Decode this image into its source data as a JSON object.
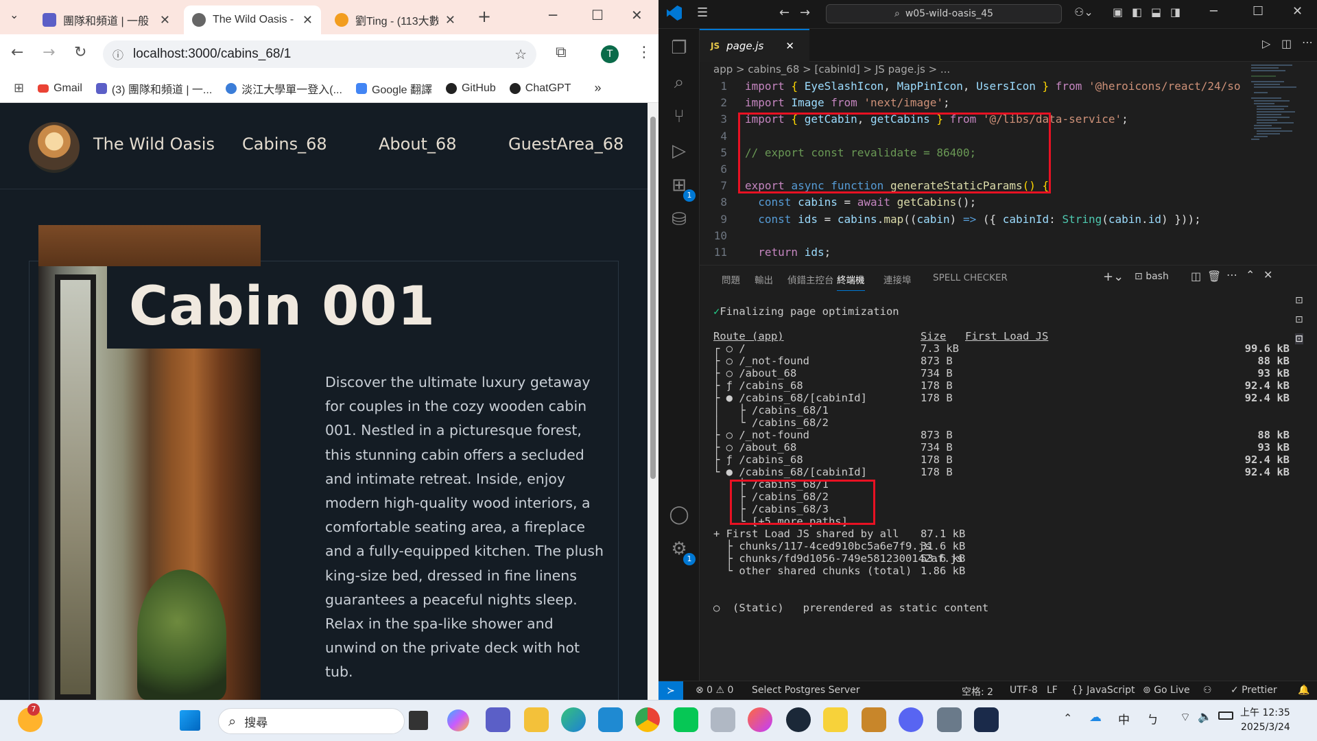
{
  "browser": {
    "tabs": [
      {
        "title": "團隊和頻道 | 一般",
        "icon": "teams-icon"
      },
      {
        "title": "The Wild Oasis - ",
        "icon": "globe-icon"
      },
      {
        "title": "劉Ting - (113大數",
        "icon": "cocomelon-icon"
      }
    ],
    "new_tab": "+",
    "url": "localhost:3000/cabins_68/1",
    "profile_initial": "T",
    "bookmarks": [
      {
        "label": "Gmail",
        "icon": "gmail-icon"
      },
      {
        "label": "(3) 團隊和頻道 | 一...",
        "icon": "teams-icon"
      },
      {
        "label": "淡江大學單一登入(...",
        "icon": "tku-icon"
      },
      {
        "label": "Google 翻譯",
        "icon": "translate-icon"
      },
      {
        "label": "GitHub",
        "icon": "github-icon"
      },
      {
        "label": "ChatGPT",
        "icon": "chatgpt-icon"
      }
    ],
    "more": "»"
  },
  "site": {
    "brand": "The Wild Oasis",
    "nav": [
      "Cabins_68",
      "About_68",
      "GuestArea_68"
    ],
    "cabin_title": "Cabin 001",
    "description": "Discover the ultimate luxury getaway for couples in the cozy wooden cabin 001. Nestled in a picturesque forest, this stunning cabin offers a secluded and intimate retreat. Inside, enjoy modern high-quality wood interiors, a comfortable seating area, a fireplace and a fully-equipped kitchen. The plush king-size bed, dressed in fine linens guarantees a peaceful nights sleep. Relax in the spa-like shower and unwind on the private deck with hot tub."
  },
  "vscode": {
    "search": "w05-wild-oasis_45",
    "tab": "page.js",
    "tab_lang": "JS",
    "breadcrumb": "app > cabins_68 > [cabinId] > JS page.js > ...",
    "line_numbers": [
      "1",
      "2",
      "3",
      "4",
      "5",
      "6",
      "7",
      "8",
      "9",
      "10",
      "11"
    ],
    "code_lines": [
      "import { EyeSlashIcon, MapPinIcon, UsersIcon } from '@heroicons/react/24/so",
      "import Image from 'next/image';",
      "import { getCabin, getCabins } from '@/libs/data-service';",
      "",
      "// export const revalidate = 86400;",
      "",
      "export async function generateStaticParams() {",
      "  const cabins = await getCabins();",
      "  const ids = cabins.map((cabin) => ({ cabinId: String(cabin.id) }));",
      "",
      "  return ids;"
    ],
    "panel_tabs": [
      "問題",
      "輸出",
      "偵錯主控台",
      "終端機",
      "連接埠",
      "SPELL CHECKER"
    ],
    "active_panel_tab": "終端機",
    "terminal_shell": "bash",
    "terminal": {
      "finalizing": "✓ Finalizing page optimization",
      "route_header": "Route (app)",
      "size_header": "Size",
      "first_load_header": "First Load JS",
      "rows": [
        {
          "route": "┌ ○ /",
          "size": "7.3 kB",
          "first": "99.6 kB"
        },
        {
          "route": "├ ○ /_not-found",
          "size": "873 B",
          "first": "88 kB"
        },
        {
          "route": "├ ○ /about_68",
          "size": "734 B",
          "first": "93 kB"
        },
        {
          "route": "├ ƒ /cabins_68",
          "size": "178 B",
          "first": "92.4 kB"
        },
        {
          "route": "├ ● /cabins_68/[cabinId]",
          "size": "178 B",
          "first": "92.4 kB"
        },
        {
          "route": "│   ├ /cabins_68/1",
          "size": "",
          "first": ""
        },
        {
          "route": "│   └ /cabins_68/2",
          "size": "",
          "first": ""
        },
        {
          "route": "├ ○ /_not-found",
          "size": "873 B",
          "first": "88 kB"
        },
        {
          "route": "├ ○ /about_68",
          "size": "734 B",
          "first": "93 kB"
        },
        {
          "route": "├ ƒ /cabins_68",
          "size": "178 B",
          "first": "92.4 kB"
        },
        {
          "route": "└ ● /cabins_68/[cabinId]",
          "size": "178 B",
          "first": "92.4 kB"
        },
        {
          "route": "    ├ /cabins_68/1",
          "size": "",
          "first": ""
        },
        {
          "route": "    ├ /cabins_68/2",
          "size": "",
          "first": ""
        },
        {
          "route": "    ├ /cabins_68/3",
          "size": "",
          "first": ""
        },
        {
          "route": "    └ [+5 more paths]",
          "size": "",
          "first": ""
        },
        {
          "route": "+ First Load JS shared by all",
          "size": "87.1 kB",
          "first": ""
        },
        {
          "route": "  ├ chunks/117-4ced910bc5a6e7f9.js",
          "size": "31.6 kB",
          "first": ""
        },
        {
          "route": "  ├ chunks/fd9d1056-749e5812300142af.js",
          "size": "53.6 kB",
          "first": ""
        },
        {
          "route": "  └ other shared chunks (total)",
          "size": "1.86 kB",
          "first": ""
        }
      ],
      "legend_static": "○  (Static)   prerendered as static content"
    },
    "status": {
      "errors": "⊗ 0 ⚠ 0",
      "postgres": "Select Postgres Server",
      "spaces": "空格: 2",
      "encoding": "UTF-8",
      "eol": "LF",
      "language": "{} JavaScript",
      "golive": "Go Live",
      "prettier": "✓ Prettier"
    }
  },
  "taskbar": {
    "search_placeholder": "搜尋",
    "weather_badge": "7",
    "time": "上午 12:35",
    "date": "2025/3/24",
    "ime": "中"
  }
}
